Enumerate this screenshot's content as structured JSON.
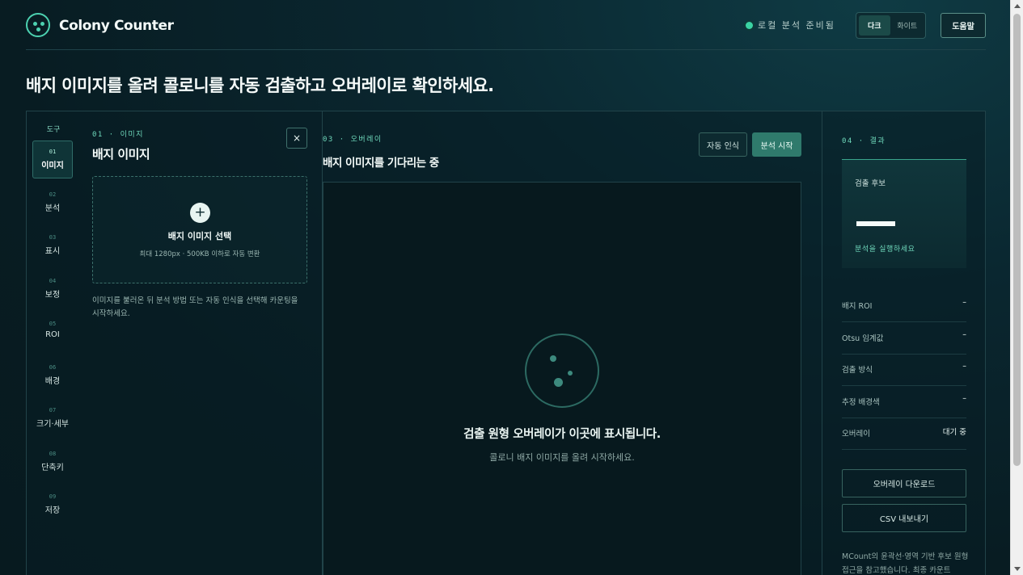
{
  "app": {
    "name": "Colony Counter"
  },
  "header": {
    "status": "로컬 분석 준비됨",
    "theme": {
      "dark": "다크",
      "white": "화이트",
      "selected": "다크"
    },
    "help": "도움말"
  },
  "headline": "배지 이미지를 올려 콜로니를 자동 검출하고 오버레이로 확인하세요.",
  "tools": {
    "title": "도구",
    "items": [
      {
        "num": "01",
        "label": "이미지",
        "active": true
      },
      {
        "num": "02",
        "label": "분석"
      },
      {
        "num": "03",
        "label": "표시"
      },
      {
        "num": "04",
        "label": "보정"
      },
      {
        "num": "05",
        "label": "ROI"
      },
      {
        "num": "06",
        "label": "배경"
      },
      {
        "num": "07",
        "label": "크기·세부"
      },
      {
        "num": "08",
        "label": "단축키"
      },
      {
        "num": "09",
        "label": "저장"
      }
    ]
  },
  "image_panel": {
    "section": "01 · 이미지",
    "title": "배지 이미지",
    "close": "×",
    "dropzone": {
      "plus": "+",
      "title": "배지 이미지 선택",
      "subtitle": "최대 1280px · 500KB 이하로 자동 변환"
    },
    "hint": "이미지를 불러온 뒤 분석 방법 또는 자동 인식을 선택해 카운팅을 시작하세요."
  },
  "overlay_panel": {
    "section": "03 · 오버레이",
    "title": "배지 이미지를 기다리는 중",
    "auto_detect": "자동 인식",
    "start_analysis": "분석 시작",
    "empty_title": "검출 원형 오버레이가 이곳에 표시됩니다.",
    "empty_subtitle": "콜로니 배지 이미지를 올려 시작하세요."
  },
  "results": {
    "section": "04 · 결과",
    "candidates_title": "검출 후보",
    "candidates_note": "분석을 실행하세요",
    "stats": [
      {
        "key": "배지 ROI",
        "value": "–"
      },
      {
        "key": "Otsu 임계값",
        "value": "–"
      },
      {
        "key": "검출 방식",
        "value": "–"
      },
      {
        "key": "추정 배경색",
        "value": "–"
      },
      {
        "key": "오버레이",
        "value": "대기 중"
      }
    ],
    "download_overlay": "오버레이 다운로드",
    "export_csv": "CSV 내보내기",
    "note": "MCount의 윤곽선·영역 기반 후보 원형 접근을 참고했습니다. 최종 카운트"
  },
  "colors": {
    "accent": "#4cd1b0",
    "status_dot": "#3ad3a3",
    "primary_button": "#2f7a6c",
    "background": "#081c22"
  }
}
